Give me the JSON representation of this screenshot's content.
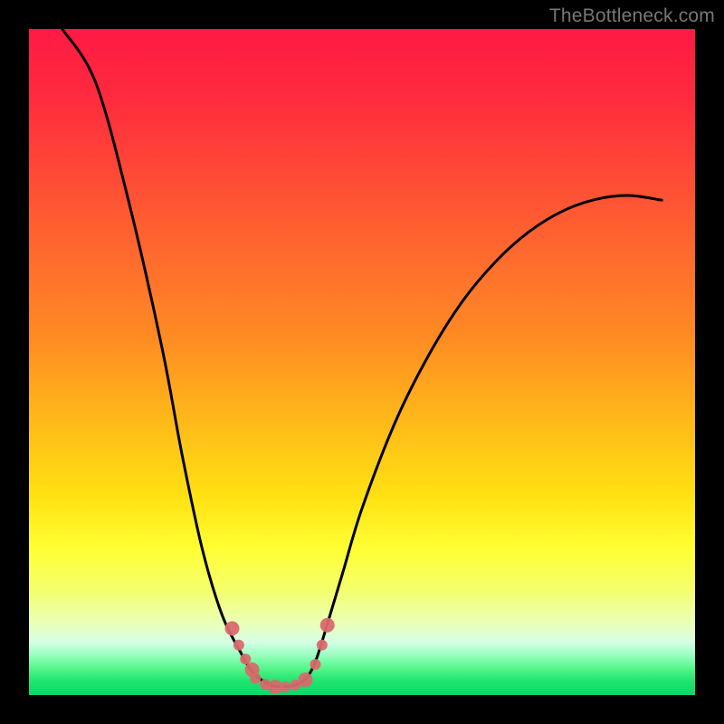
{
  "watermark": "TheBottleneck.com",
  "colors": {
    "curve": "#000000",
    "marker": "#d86a6d",
    "gradient_top": "#ff1a44",
    "gradient_bottom": "#0fd668"
  },
  "chart_data": {
    "type": "line",
    "title": "",
    "xlabel": "",
    "ylabel": "",
    "xlim": [
      0,
      100
    ],
    "ylim": [
      0,
      100
    ],
    "x": [
      0,
      5,
      10,
      15,
      20,
      23,
      26,
      29,
      32,
      33,
      34,
      35,
      36,
      37,
      38,
      39,
      40,
      41,
      42,
      43,
      44,
      47,
      50,
      55,
      60,
      65,
      70,
      75,
      80,
      85,
      90,
      95,
      100
    ],
    "series": [
      {
        "name": "bottleneck-curve",
        "values": [
          null,
          100,
          92,
          74,
          52,
          36,
          22,
          12,
          6,
          4.2,
          3.0,
          2.2,
          1.6,
          1.3,
          1.2,
          1.3,
          1.5,
          2.0,
          3.0,
          5.0,
          8,
          18,
          28,
          41,
          51,
          59,
          65,
          69.5,
          72.6,
          74.4,
          75.0,
          74.3,
          null
        ]
      }
    ],
    "vertex_x": 38,
    "markers": {
      "note": "pink dotted highlight near the vertex",
      "points": [
        {
          "x": 30.5,
          "y": 10.0
        },
        {
          "x": 31.5,
          "y": 7.5
        },
        {
          "x": 32.5,
          "y": 5.4
        },
        {
          "x": 33.5,
          "y": 3.8
        },
        {
          "x": 34.0,
          "y": 2.5
        },
        {
          "x": 35.5,
          "y": 1.6
        },
        {
          "x": 37.0,
          "y": 1.2
        },
        {
          "x": 38.5,
          "y": 1.2
        },
        {
          "x": 40.0,
          "y": 1.5
        },
        {
          "x": 41.5,
          "y": 2.3
        },
        {
          "x": 43.0,
          "y": 4.6
        },
        {
          "x": 44.0,
          "y": 7.5
        },
        {
          "x": 44.8,
          "y": 10.5
        }
      ]
    }
  }
}
